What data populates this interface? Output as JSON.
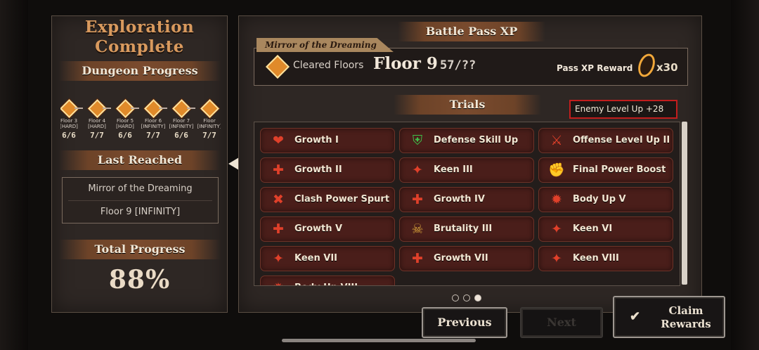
{
  "left": {
    "title_line1": "Exploration",
    "title_line2": "Complete",
    "dungeon_progress": "Dungeon Progress",
    "floors": [
      {
        "name": "Floor 3",
        "difficulty": "[HARD]",
        "count": "6/6"
      },
      {
        "name": "Floor 4",
        "difficulty": "[HARD]",
        "count": "7/7"
      },
      {
        "name": "Floor 5",
        "difficulty": "[HARD]",
        "count": "6/6"
      },
      {
        "name": "Floor 6",
        "difficulty": "[INFINITY]",
        "count": "7/7"
      },
      {
        "name": "Floor 7",
        "difficulty": "[INFINITY]",
        "count": "6/6"
      },
      {
        "name": "Floor",
        "difficulty": "[INFINITY]",
        "count": "7/7"
      }
    ],
    "last_reached": "Last Reached",
    "reached_dungeon": "Mirror of the Dreaming",
    "reached_floor": "Floor 9 [INFINITY]",
    "total_progress": "Total Progress",
    "total_value": "88%"
  },
  "battle_pass": {
    "title": "Battle Pass XP",
    "tag": "Mirror of the Dreaming",
    "cleared_label": "Cleared Floors",
    "floor": "Floor 9",
    "fraction": "57/??",
    "reward_label": "Pass XP Reward",
    "reward_count": "x30"
  },
  "trials": {
    "title": "Trials",
    "enemy_level": "Enemy Level Up +28",
    "items": [
      {
        "label": "Growth I",
        "icon": "heart-up-icon",
        "glyph": "❤"
      },
      {
        "label": "Defense Skill Up",
        "icon": "shield-plus-icon",
        "glyph": "⛨"
      },
      {
        "label": "Offense Level Up II",
        "icon": "swords-up-icon",
        "glyph": "⚔"
      },
      {
        "label": "Growth II",
        "icon": "heart-plus-icon",
        "glyph": "✚"
      },
      {
        "label": "Keen III",
        "icon": "crit-up-icon",
        "glyph": "✦"
      },
      {
        "label": "Final Power Boost",
        "icon": "fist-icon",
        "glyph": "✊"
      },
      {
        "label": "Clash Power Spurt",
        "icon": "clash-icon",
        "glyph": "✖"
      },
      {
        "label": "Growth IV",
        "icon": "heart-plus-icon",
        "glyph": "✚"
      },
      {
        "label": "Body Up V",
        "icon": "body-up-icon",
        "glyph": "✹"
      },
      {
        "label": "Growth V",
        "icon": "heart-plus-icon",
        "glyph": "✚"
      },
      {
        "label": "Brutality III",
        "icon": "brutality-icon",
        "glyph": "☠"
      },
      {
        "label": "Keen VI",
        "icon": "crit-up-icon",
        "glyph": "✦"
      },
      {
        "label": "Keen VII",
        "icon": "crit-up-icon",
        "glyph": "✦"
      },
      {
        "label": "Growth VII",
        "icon": "heart-plus-icon",
        "glyph": "✚"
      },
      {
        "label": "Keen VIII",
        "icon": "crit-up-icon",
        "glyph": "✦"
      },
      {
        "label": "Body Up VIII",
        "icon": "body-up-icon",
        "glyph": "✹"
      }
    ]
  },
  "pagination": {
    "pages": 3,
    "active": 3
  },
  "buttons": {
    "previous": "Previous",
    "next": "Next",
    "claim_line1": "Claim",
    "claim_line2": "Rewards"
  },
  "colors": {
    "accent_orange": "#d99a5e",
    "trial_red": "#4a1e1a",
    "enemy_border": "#c21d1d",
    "diamond_orange": "#e08a2a"
  }
}
